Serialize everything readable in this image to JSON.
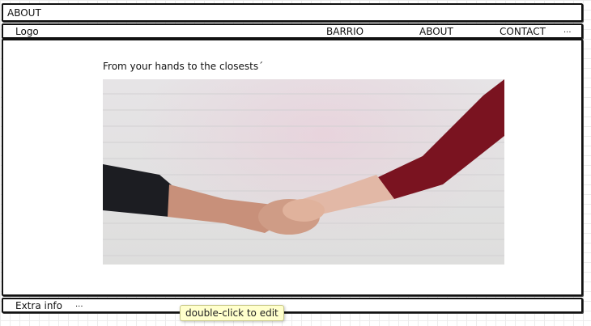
{
  "header": {
    "title": "ABOUT"
  },
  "nav": {
    "logo": "Logo",
    "items": [
      {
        "label": "BARRIO"
      },
      {
        "label": "ABOUT"
      },
      {
        "label": "CONTACT"
      },
      {
        "label": "..."
      }
    ]
  },
  "main": {
    "tagline": "From your hands to the closests´",
    "image": {
      "icon": "handshake-photo"
    }
  },
  "footer": {
    "info": "Extra info",
    "more": "..."
  },
  "tooltip": {
    "text": "double-click to edit"
  }
}
